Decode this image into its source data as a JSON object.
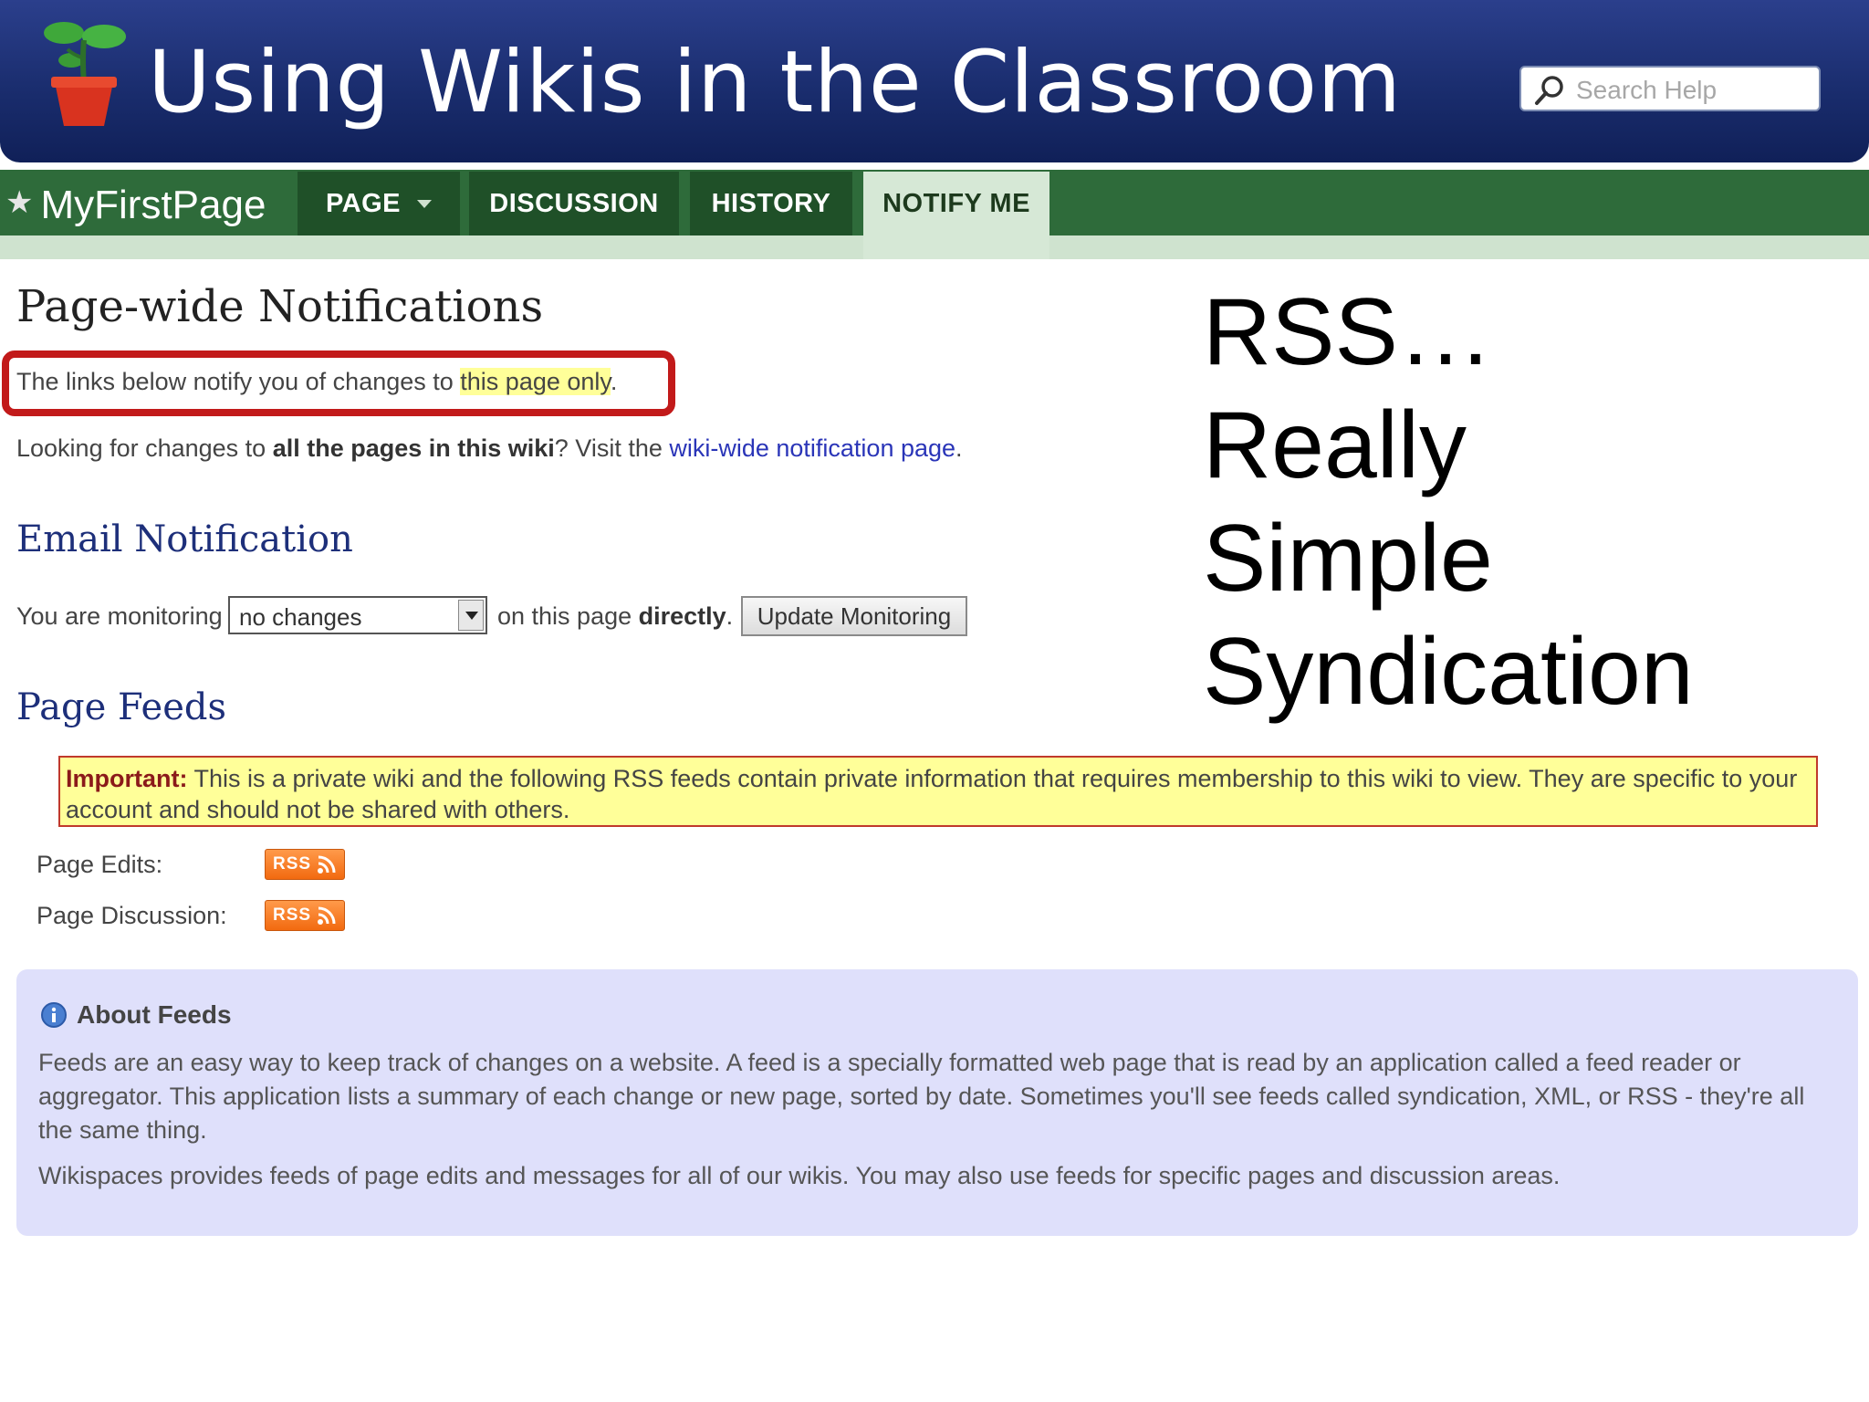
{
  "header": {
    "title": "Using Wikis in the Classroom",
    "search_placeholder": "Search Help",
    "logo_icon": "potted-plant-icon"
  },
  "nav": {
    "page_name": "MyFirstPage",
    "tabs": [
      {
        "label": "PAGE",
        "has_dropdown": true
      },
      {
        "label": "DISCUSSION"
      },
      {
        "label": "HISTORY"
      },
      {
        "label": "NOTIFY ME",
        "active": true
      }
    ]
  },
  "content": {
    "heading": "Page-wide Notifications",
    "intro_prefix": "The links below notify you of changes to ",
    "intro_highlight": "this page only",
    "intro_suffix": ".",
    "looking_prefix": "Looking for changes to ",
    "looking_bold": "all the pages in this wiki",
    "looking_mid": "? Visit the ",
    "looking_link": "wiki-wide notification page",
    "looking_suffix": ".",
    "email_heading": "Email Notification",
    "monitoring_prefix": "You are monitoring",
    "monitoring_value": "no changes",
    "monitoring_mid": "on this page ",
    "monitoring_bold": "directly",
    "monitoring_suffix": ".",
    "update_button": "Update Monitoring",
    "feeds_heading": "Page Feeds",
    "important_label": "Important:",
    "important_text": " This is a private wiki and the following RSS feeds contain private information that requires membership to this wiki to view. They are specific to your account and should not be shared with others.",
    "feeds": [
      {
        "label": "Page Edits:",
        "badge": "RSS"
      },
      {
        "label": "Page Discussion:",
        "badge": "RSS"
      }
    ]
  },
  "about": {
    "title": "About Feeds",
    "p1": "Feeds are an easy way to keep track of changes on a website. A feed is a specially formatted web page that is read by an application called a feed reader or aggregator. This application lists a summary of each change or new page, sorted by date. Sometimes you'll see feeds called syndication, XML, or RSS - they're all the same thing.",
    "p2": "Wikispaces provides feeds of page edits and messages for all of our wikis. You may also use feeds for specific pages and discussion areas."
  },
  "side_text": {
    "line1": "RSS…",
    "line2": "Really",
    "line3": "Simple",
    "line4": "Syndication"
  },
  "colors": {
    "header_blue": "#1a2d6e",
    "nav_green": "#2e6b3a",
    "callout_red": "#c21a1a",
    "highlight_yellow": "#ffff99",
    "about_lavender": "#dfe0fb",
    "rss_orange": "#f26a10"
  }
}
